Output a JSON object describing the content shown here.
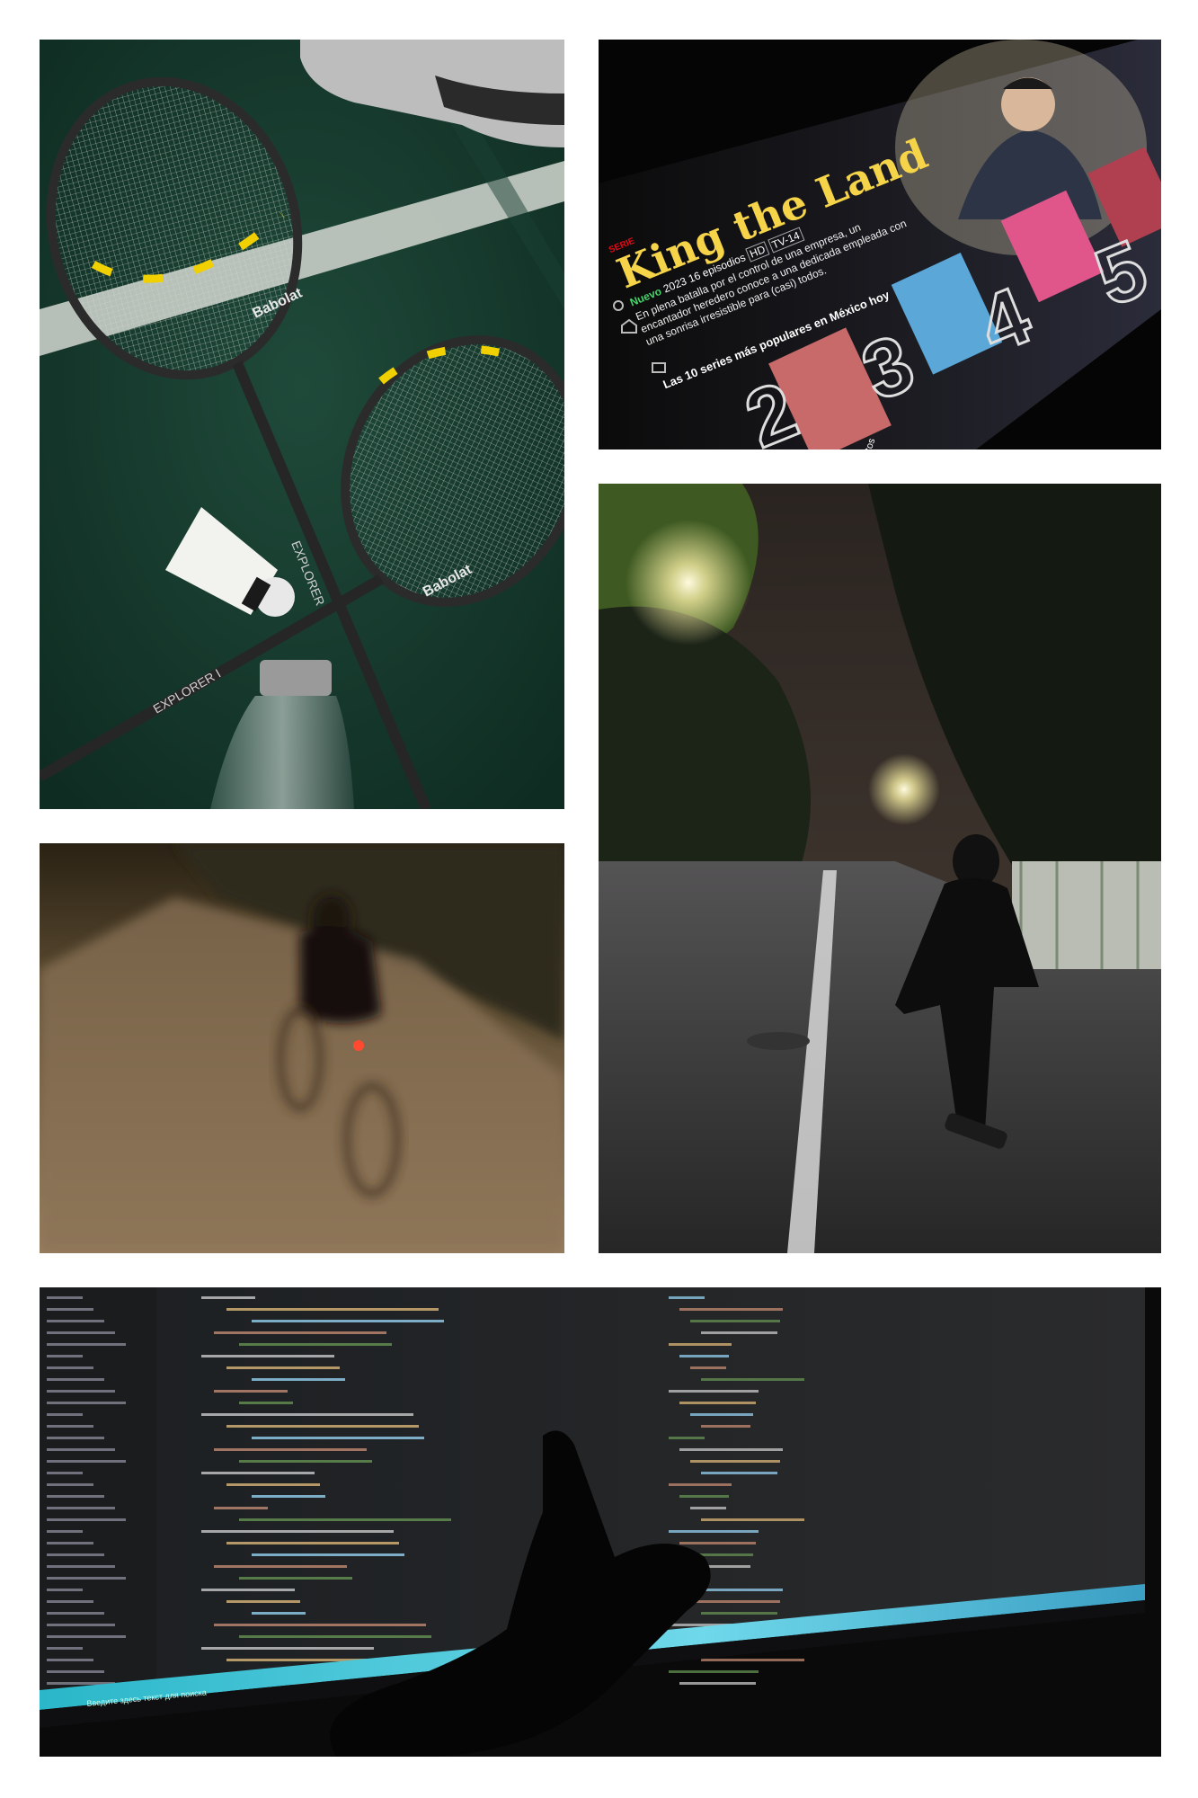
{
  "collage": {
    "photos": [
      {
        "subject": "badminton-rackets-shuttlecock",
        "brand_text": "Babolat",
        "model_text": "EXPLORER I"
      },
      {
        "subject": "streaming-tv-screen"
      },
      {
        "subject": "night-street-skateboarder"
      },
      {
        "subject": "night-cyclist-blur"
      },
      {
        "subject": "code-editor-monitor-hand"
      }
    ]
  },
  "tv": {
    "badge": "SERIE",
    "title": "King the Land",
    "tag_new": "Nuevo",
    "year": "2023",
    "episodes": "16 episodios",
    "hd": "HD",
    "rating": "TV-14",
    "synopsis_1": "En plena batalla por el control de una empresa, un",
    "synopsis_2": "encantador heredero conoce a una dedicada empleada con",
    "synopsis_3": "una sonrisa irresistible para (casi) todos.",
    "row_title": "Las 10 series más populares en México hoy",
    "ranks": [
      "2",
      "3",
      "4",
      "5"
    ],
    "row_2": "lentos",
    "accent": "#e50914",
    "title_color": "#f5d44a"
  },
  "taskbar": {
    "search_placeholder": "Введите здесь текст для поиска"
  }
}
